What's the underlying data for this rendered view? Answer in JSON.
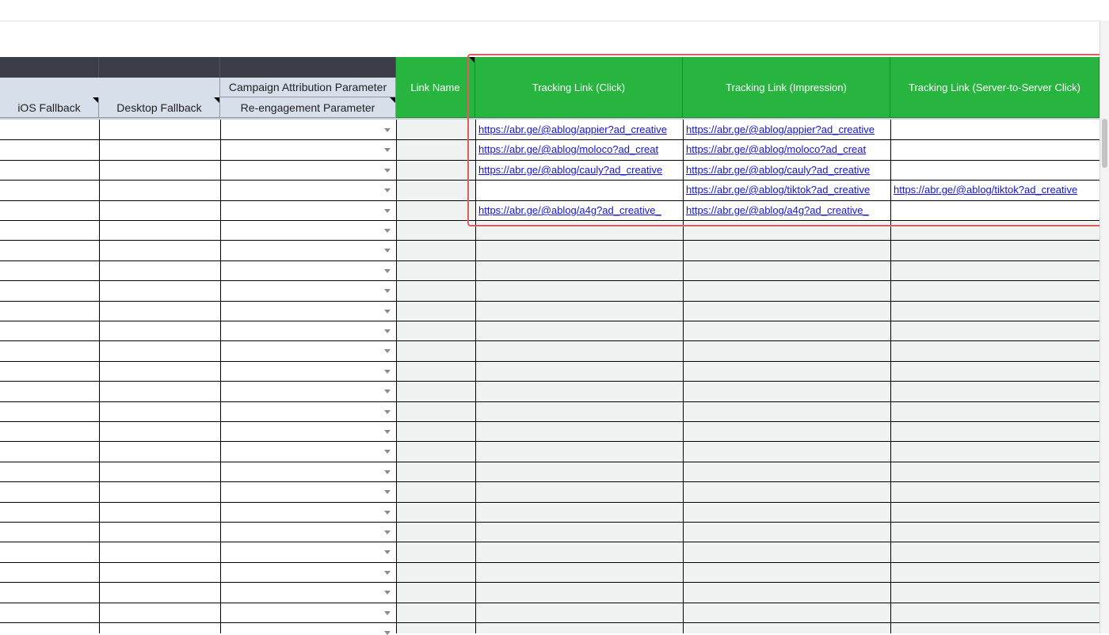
{
  "header_groups": {
    "campaign_attribution_parameter": "Campaign Attribution Parameter"
  },
  "columns": {
    "ios_fallback": "iOS Fallback",
    "desktop_fallback": "Desktop Fallback",
    "reengagement_parameter": "Re-engagement Parameter",
    "link_name": "Link Name",
    "tracking_click": "Tracking Link (Click)",
    "tracking_impression": "Tracking Link (Impression)",
    "tracking_s2s_click": "Tracking Link (Server-to-Server Click)"
  },
  "rows": [
    {
      "click": "https://abr.ge/@ablog/appier?ad_creative",
      "impression": "https://abr.ge/@ablog/appier?ad_creative",
      "s2s": ""
    },
    {
      "click": "https://abr.ge/@ablog/moloco?ad_creat",
      "impression": "https://abr.ge/@ablog/moloco?ad_creat",
      "s2s": ""
    },
    {
      "click": "https://abr.ge/@ablog/cauly?ad_creative",
      "impression": "https://abr.ge/@ablog/cauly?ad_creative",
      "s2s": ""
    },
    {
      "click": "",
      "impression": "https://abr.ge/@ablog/tiktok?ad_creative",
      "s2s": "https://abr.ge/@ablog/tiktok?ad_creative"
    },
    {
      "click": "https://abr.ge/@ablog/a4g?ad_creative_",
      "impression": "https://abr.ge/@ablog/a4g?ad_creative_",
      "s2s": ""
    }
  ],
  "colors": {
    "header_green": "#27b43f",
    "header_dark": "#3b3e47",
    "subheader_blue": "#d7e0ea",
    "tinted_column": "#eef3f2",
    "link_blue": "#1414d8",
    "highlight_red": "#e05c5c"
  },
  "icons": {
    "dropdown": "dropdown-caret-icon"
  }
}
